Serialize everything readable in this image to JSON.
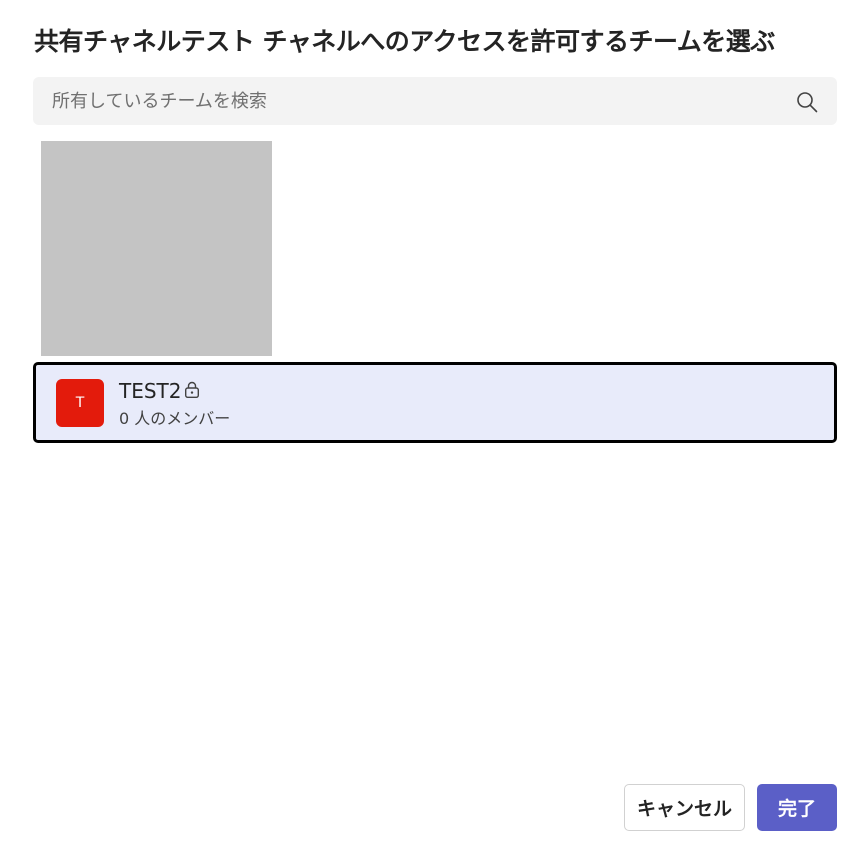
{
  "dialog": {
    "title": "共有チャネルテスト チャネルへのアクセスを許可するチームを選ぶ"
  },
  "search": {
    "placeholder": "所有しているチームを検索",
    "value": "",
    "icon": "search-icon"
  },
  "teams": [
    {
      "avatar_letter": "T",
      "avatar_color": "#e31b0c",
      "name": "TEST2",
      "privacy_icon": "lock-icon",
      "members": "0 人のメンバー",
      "selected": true
    }
  ],
  "buttons": {
    "cancel_label": "キャンセル",
    "done_label": "完了"
  },
  "colors": {
    "accent": "#5b5fc7",
    "selected_row_bg": "#e8ebfa",
    "search_bg": "#f3f3f3",
    "placeholder_block": "#c4c4c4"
  }
}
